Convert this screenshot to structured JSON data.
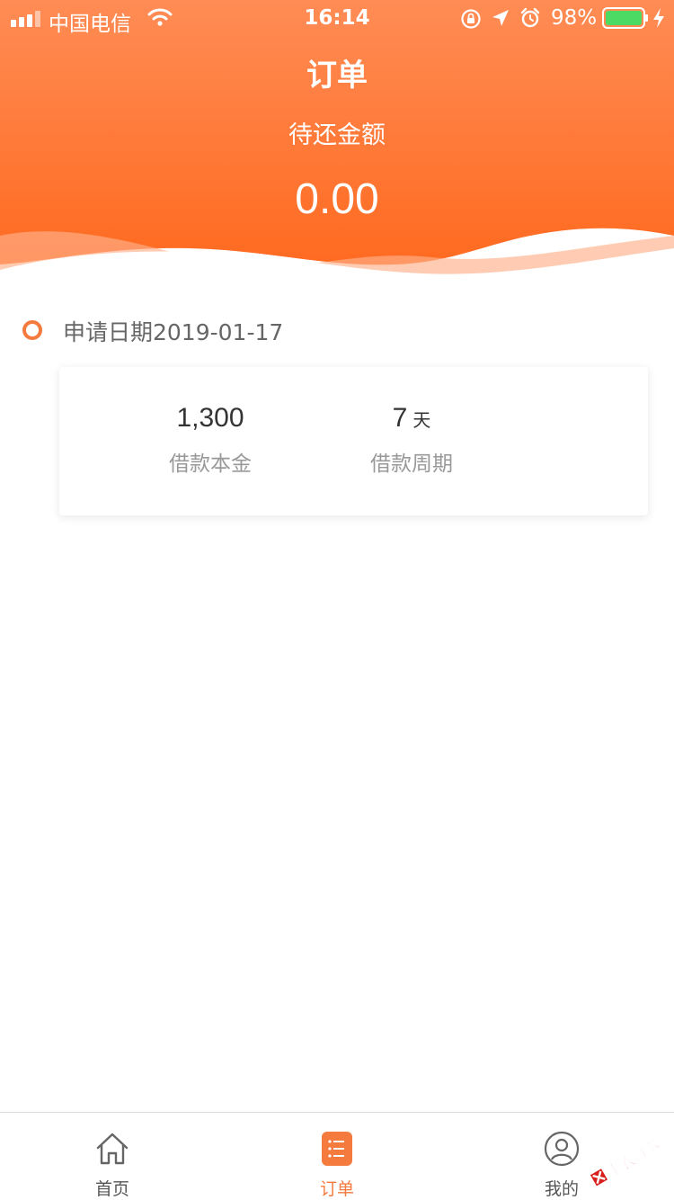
{
  "status_bar": {
    "carrier": "中国电信",
    "time": "16:14",
    "battery_percent": "98%",
    "icons": [
      "signal-icon",
      "wifi-icon",
      "orientation-lock-icon",
      "location-arrow-icon",
      "alarm-icon",
      "battery-icon",
      "charging-icon"
    ]
  },
  "header": {
    "title": "订单",
    "amount_label": "待还金额",
    "amount_value": "0.00"
  },
  "order": {
    "apply_date": "申请日期2019-01-17",
    "principal_value": "1,300",
    "principal_label": "借款本金",
    "period_value": "7",
    "period_unit": "天",
    "period_label": "借款周期"
  },
  "tab_bar": {
    "tabs": [
      {
        "label": "首页",
        "icon": "home-icon",
        "active": false
      },
      {
        "label": "订单",
        "icon": "order-list-icon",
        "active": true
      },
      {
        "label": "我的",
        "icon": "user-icon",
        "active": false
      }
    ]
  },
  "watermark": {
    "text": "卡农社区"
  },
  "colors": {
    "accent": "#f47a3e",
    "header_gradient_top": "#ff8a52",
    "header_gradient_bottom": "#ff6a22",
    "text_primary": "#333333",
    "text_secondary": "#999999"
  }
}
